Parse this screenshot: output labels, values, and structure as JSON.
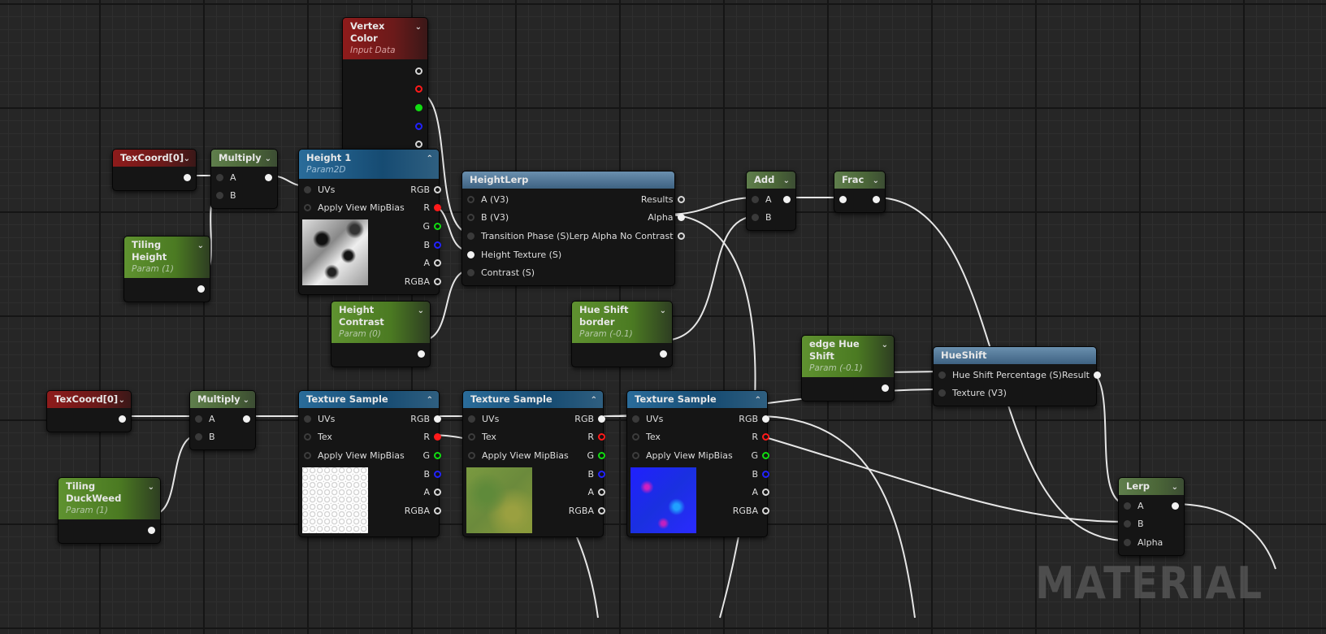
{
  "watermark": "MATERIAL",
  "colors": {
    "red_pin": "#ff1a1a",
    "green_pin": "#11dd11",
    "blue_pin": "#2222ff",
    "wire": "#e6e6e6"
  },
  "nodes": {
    "vertex_color": {
      "title": "Vertex Color",
      "subtitle": "Input Data",
      "style": "red",
      "chevron": true,
      "inputs": [],
      "outputs": [
        {
          "label": "",
          "pin": "ring"
        },
        {
          "label": "",
          "pin": "ring-red"
        },
        {
          "label": "",
          "pin": "filled-green"
        },
        {
          "label": "",
          "pin": "ring-blue"
        },
        {
          "label": "",
          "pin": "ring"
        }
      ]
    },
    "texcoord_top": {
      "title": "TexCoord[0]",
      "style": "red",
      "chevron": true,
      "inputs": [],
      "outputs": [
        {
          "label": "",
          "pin": "filled"
        }
      ]
    },
    "multiply_top": {
      "title": "Multiply",
      "style": "math",
      "chevron": true,
      "inputs": [
        {
          "label": "A",
          "pin": "dark"
        },
        {
          "label": "B",
          "pin": "dark"
        }
      ],
      "outputs": [
        {
          "label": "",
          "pin": "filled"
        }
      ]
    },
    "tiling_height": {
      "title": "Tiling Height",
      "subtitle": "Param (1)",
      "style": "param",
      "chevron": true,
      "inputs": [],
      "outputs": [
        {
          "label": "",
          "pin": "filled"
        }
      ]
    },
    "height1": {
      "title": "Height 1",
      "subtitle": "Param2D",
      "style": "tex",
      "chevron": "up",
      "preview": "height",
      "inputs": [
        {
          "label": "UVs",
          "pin": "dark"
        },
        {
          "label": "Apply View MipBias",
          "pin": "dark-ring"
        }
      ],
      "outputs": [
        {
          "label": "RGB",
          "pin": "ring"
        },
        {
          "label": "R",
          "pin": "filled-red"
        },
        {
          "label": "G",
          "pin": "ring-green"
        },
        {
          "label": "B",
          "pin": "ring-blue"
        },
        {
          "label": "A",
          "pin": "ring"
        },
        {
          "label": "RGBA",
          "pin": "ring"
        }
      ]
    },
    "height_lerp": {
      "title": "HeightLerp",
      "style": "func",
      "inputs": [
        {
          "label": "A (V3)",
          "pin": "dark-ring"
        },
        {
          "label": "B (V3)",
          "pin": "dark-ring"
        },
        {
          "label": "Transition Phase (S)",
          "pin": "dark"
        },
        {
          "label": "Height Texture (S)",
          "pin": "filled"
        },
        {
          "label": "Contrast (S)",
          "pin": "dark"
        }
      ],
      "outputs": [
        {
          "label": "Results",
          "pin": "ring"
        },
        {
          "label": "Alpha",
          "pin": "filled"
        },
        {
          "label": "Lerp Alpha No Contrast",
          "pin": "ring"
        }
      ]
    },
    "add": {
      "title": "Add",
      "style": "math",
      "chevron": true,
      "inputs": [
        {
          "label": "A",
          "pin": "dark"
        },
        {
          "label": "B",
          "pin": "dark"
        }
      ],
      "outputs": [
        {
          "label": "",
          "pin": "filled"
        }
      ]
    },
    "frac": {
      "title": "Frac",
      "style": "math",
      "chevron": true,
      "inputs": [
        {
          "label": "",
          "pin": "filled"
        }
      ],
      "outputs": [
        {
          "label": "",
          "pin": "filled"
        }
      ]
    },
    "height_contrast": {
      "title": "Height Contrast",
      "subtitle": "Param (0)",
      "style": "param",
      "chevron": true,
      "inputs": [],
      "outputs": [
        {
          "label": "",
          "pin": "filled"
        }
      ]
    },
    "hue_shift_border": {
      "title": "Hue Shift border",
      "subtitle": "Param (-0.1)",
      "style": "param",
      "chevron": true,
      "inputs": [],
      "outputs": [
        {
          "label": "",
          "pin": "filled"
        }
      ]
    },
    "edge_hue_shift": {
      "title": "edge Hue Shift",
      "subtitle": "Param (-0.1)",
      "style": "param",
      "chevron": true,
      "inputs": [],
      "outputs": [
        {
          "label": "",
          "pin": "filled"
        }
      ]
    },
    "hueshift": {
      "title": "HueShift",
      "style": "func",
      "inputs": [
        {
          "label": "Hue Shift Percentage (S)",
          "pin": "dark"
        },
        {
          "label": "Texture (V3)",
          "pin": "dark"
        }
      ],
      "outputs": [
        {
          "label": "Result",
          "pin": "filled"
        }
      ]
    },
    "texcoord_bottom": {
      "title": "TexCoord[0]",
      "style": "red",
      "chevron": true,
      "inputs": [],
      "outputs": [
        {
          "label": "",
          "pin": "filled"
        }
      ]
    },
    "multiply_bottom": {
      "title": "Multiply",
      "style": "math",
      "chevron": true,
      "inputs": [
        {
          "label": "A",
          "pin": "dark"
        },
        {
          "label": "B",
          "pin": "dark"
        }
      ],
      "outputs": [
        {
          "label": "",
          "pin": "filled"
        }
      ]
    },
    "tiling_duckweed": {
      "title": "Tiling DuckWeed",
      "subtitle": "Param (1)",
      "style": "param",
      "chevron": true,
      "inputs": [],
      "outputs": [
        {
          "label": "",
          "pin": "filled"
        }
      ]
    },
    "texture_sample_1": {
      "title": "Texture Sample",
      "style": "tex",
      "chevron": "up",
      "preview": "noise",
      "inputs": [
        {
          "label": "UVs",
          "pin": "dark"
        },
        {
          "label": "Tex",
          "pin": "dark-ring"
        },
        {
          "label": "Apply View MipBias",
          "pin": "dark-ring"
        }
      ],
      "outputs": [
        {
          "label": "RGB",
          "pin": "filled"
        },
        {
          "label": "R",
          "pin": "filled-red"
        },
        {
          "label": "G",
          "pin": "ring-green"
        },
        {
          "label": "B",
          "pin": "ring-blue"
        },
        {
          "label": "A",
          "pin": "ring"
        },
        {
          "label": "RGBA",
          "pin": "ring"
        }
      ]
    },
    "texture_sample_2": {
      "title": "Texture Sample",
      "style": "tex",
      "chevron": "up",
      "preview": "moss",
      "inputs": [
        {
          "label": "UVs",
          "pin": "dark"
        },
        {
          "label": "Tex",
          "pin": "dark-ring"
        },
        {
          "label": "Apply View MipBias",
          "pin": "dark-ring"
        }
      ],
      "outputs": [
        {
          "label": "RGB",
          "pin": "filled"
        },
        {
          "label": "R",
          "pin": "ring-red"
        },
        {
          "label": "G",
          "pin": "ring-green"
        },
        {
          "label": "B",
          "pin": "ring-blue"
        },
        {
          "label": "A",
          "pin": "ring"
        },
        {
          "label": "RGBA",
          "pin": "ring"
        }
      ]
    },
    "texture_sample_3": {
      "title": "Texture Sample",
      "style": "tex",
      "chevron": "up",
      "preview": "normal",
      "inputs": [
        {
          "label": "UVs",
          "pin": "dark"
        },
        {
          "label": "Tex",
          "pin": "dark-ring"
        },
        {
          "label": "Apply View MipBias",
          "pin": "dark-ring"
        }
      ],
      "outputs": [
        {
          "label": "RGB",
          "pin": "filled"
        },
        {
          "label": "R",
          "pin": "ring-red"
        },
        {
          "label": "G",
          "pin": "ring-green"
        },
        {
          "label": "B",
          "pin": "ring-blue"
        },
        {
          "label": "A",
          "pin": "ring"
        },
        {
          "label": "RGBA",
          "pin": "ring"
        }
      ]
    },
    "lerp": {
      "title": "Lerp",
      "style": "math",
      "chevron": true,
      "inputs": [
        {
          "label": "A",
          "pin": "dark"
        },
        {
          "label": "B",
          "pin": "dark"
        },
        {
          "label": "Alpha",
          "pin": "dark"
        }
      ],
      "outputs": [
        {
          "label": "",
          "pin": "filled"
        }
      ]
    }
  }
}
